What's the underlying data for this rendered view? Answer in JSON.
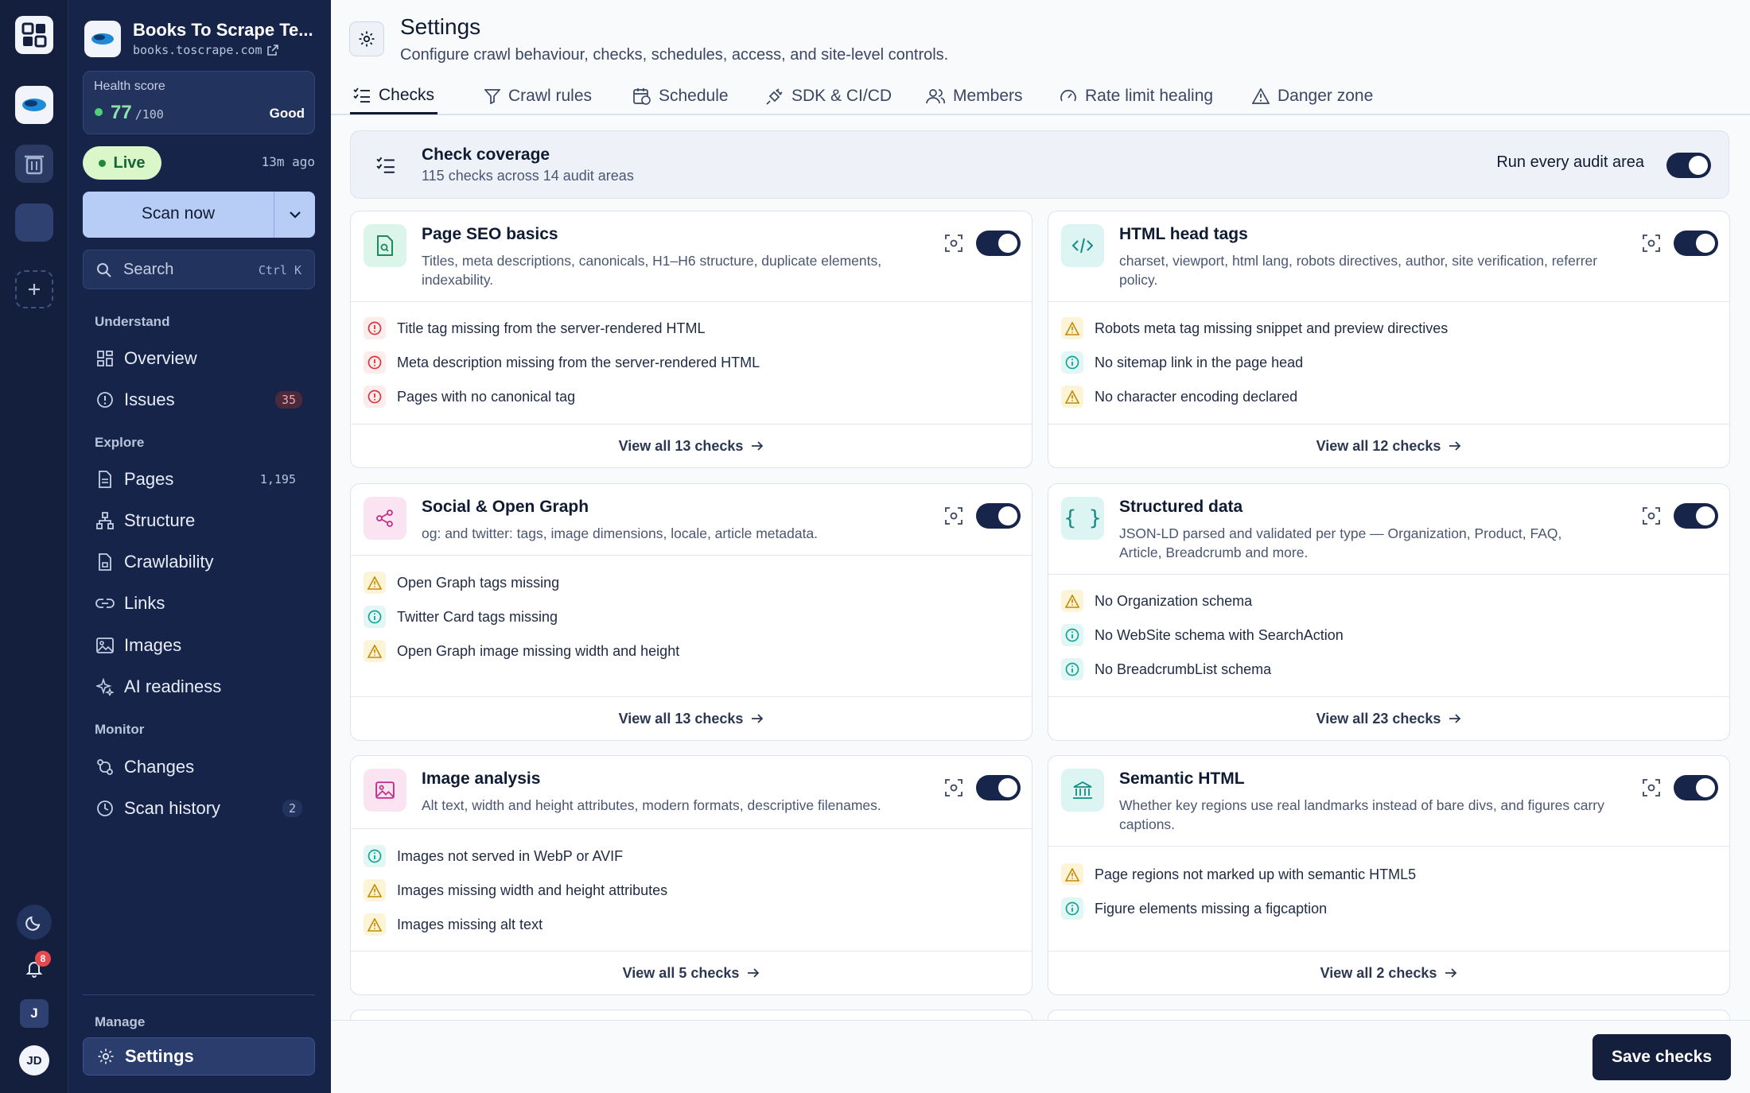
{
  "site": {
    "name": "Books To Scrape Te...",
    "domain": "books.toscrape.com"
  },
  "health": {
    "label": "Health score",
    "score": "77",
    "max": "/100",
    "status": "Good"
  },
  "live": {
    "label": "Live",
    "ago": "13m ago"
  },
  "scan_button": "Scan now",
  "search": {
    "label": "Search",
    "shortcut": "Ctrl K"
  },
  "sections": {
    "understand": "Understand",
    "explore": "Explore",
    "monitor": "Monitor",
    "manage": "Manage"
  },
  "nav": {
    "overview": "Overview",
    "issues": "Issues",
    "issues_count": "35",
    "pages": "Pages",
    "pages_count": "1,195",
    "structure": "Structure",
    "crawlability": "Crawlability",
    "links": "Links",
    "images": "Images",
    "ai_readiness": "AI readiness",
    "changes": "Changes",
    "scan_history": "Scan history",
    "scan_history_count": "2",
    "settings": "Settings"
  },
  "rail": {
    "notifications_count": "8",
    "user_initial": "J",
    "user_avatar": "JD"
  },
  "header": {
    "title": "Settings",
    "subtitle": "Configure crawl behaviour, checks, schedules, access, and site-level controls."
  },
  "tabs": {
    "checks": "Checks",
    "crawl_rules": "Crawl rules",
    "schedule": "Schedule",
    "sdk": "SDK & CI/CD",
    "members": "Members",
    "rate_limit": "Rate limit healing",
    "danger": "Danger zone"
  },
  "coverage": {
    "title": "Check coverage",
    "subtitle": "115 checks across 14 audit areas",
    "toggle_label": "Run every audit area"
  },
  "cards": {
    "seo": {
      "title": "Page SEO basics",
      "desc": "Titles, meta descriptions, canonicals, H1–H6 structure, duplicate elements, indexability.",
      "checks": [
        "Title tag missing from the server-rendered HTML",
        "Meta description missing from the server-rendered HTML",
        "Pages with no canonical tag"
      ],
      "footer": "View all 13 checks"
    },
    "head": {
      "title": "HTML head tags",
      "desc": "charset, viewport, html lang, robots directives, author, site verification, referrer policy.",
      "checks": [
        "Robots meta tag missing snippet and preview directives",
        "No sitemap link in the page head",
        "No character encoding declared"
      ],
      "footer": "View all 12 checks"
    },
    "social": {
      "title": "Social & Open Graph",
      "desc": "og: and twitter: tags, image dimensions, locale, article metadata.",
      "checks": [
        "Open Graph tags missing",
        "Twitter Card tags missing",
        "Open Graph image missing width and height"
      ],
      "footer": "View all 13 checks"
    },
    "structured": {
      "title": "Structured data",
      "desc": "JSON-LD parsed and validated per type — Organization, Product, FAQ, Article, Breadcrumb and more.",
      "checks": [
        "No Organization schema",
        "No WebSite schema with SearchAction",
        "No BreadcrumbList schema"
      ],
      "footer": "View all 23 checks"
    },
    "image": {
      "title": "Image analysis",
      "desc": "Alt text, width and height attributes, modern formats, descriptive filenames.",
      "checks": [
        "Images not served in WebP or AVIF",
        "Images missing width and height attributes",
        "Images missing alt text"
      ],
      "footer": "View all 5 checks"
    },
    "semantic": {
      "title": "Semantic HTML",
      "desc": "Whether key regions use real landmarks instead of bare divs, and figures carry captions.",
      "checks": [
        "Page regions not marked up with semantic HTML5",
        "Figure elements missing a figcaption"
      ],
      "footer": "View all 2 checks"
    }
  },
  "save_button": "Save checks",
  "colors": {
    "sidebar_bg": "#16244a",
    "accent_blue": "#b8cdf6",
    "live_green": "#d9f7c9",
    "toggle_dark": "#17254a",
    "error_red": "#d9363e",
    "warn_amber": "#c48a06",
    "info_teal": "#14a39a"
  }
}
